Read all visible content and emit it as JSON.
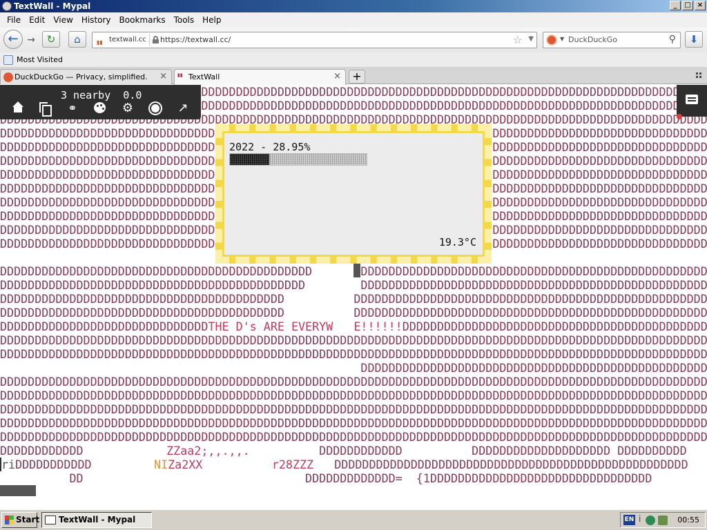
{
  "window": {
    "title": "TextWall - Mypal",
    "controls": {
      "minimize": "_",
      "maximize": "□",
      "close": "×"
    }
  },
  "menu": [
    "File",
    "Edit",
    "View",
    "History",
    "Bookmarks",
    "Tools",
    "Help"
  ],
  "nav": {
    "site_identity": "textwall.cc",
    "url": "https://textwall.cc/",
    "search_placeholder": "DuckDuckGo",
    "icons": [
      "back-icon",
      "forward-icon",
      "reload-icon",
      "home-icon",
      "lock-icon",
      "star-icon",
      "search-icon",
      "download-icon"
    ]
  },
  "bookmarks": {
    "most_visited": "Most Visited"
  },
  "tabs": [
    {
      "label": "DuckDuckGo — Privacy, simplified.",
      "active": false
    },
    {
      "label": "TextWall",
      "active": true
    }
  ],
  "newtab": "+",
  "textwall": {
    "status": "3 nearby  0.0",
    "toolbar_icons": [
      "home-icon",
      "copy-icon",
      "link-icon",
      "palette-icon",
      "settings-icon",
      "brightness-icon",
      "arrow-icon"
    ],
    "billboard": {
      "label": "2022 - 28.95%",
      "progress": 0.2895,
      "temperature": "19.3°C",
      "colors": {
        "frame": "#f3d84a",
        "dash": "#fbf0a8"
      }
    },
    "rows": [
      {
        "text": "DDDDDDDDDDDDDDDDDDDDDDDDDDDDDDDDDDDDDDDDDDDDDDDDDDDDDDDDDDDDDDDDDDDDDDDDDDDDDDDDDDDDDDDDDDDDDDDDDDDDDDDDDDDD"
      },
      {
        "text": "DDDDDDDDDDDDDDDDDDDDDDDDDDDDDDDDDDDDDDDDDDDDDDDDDDDDDDDDDDDDDDDDDDDDDDDDDDDDDDDDDDDDDDDDDDDDDDDDDDDDDDDDDDDDDD"
      },
      {
        "text": "DDDDDDDDDDDDDDDDDDDDDDDDDDDDDDDDDDDDDDDDDDDDDDDDDDDDDDDDDDDDDDDDDDDDDDDDDDDDDDDDDDDDDDDDDDDDDDDDDDDDDDDDDDDDDD"
      },
      {
        "text": "DDDDDDDDDDDDDDDDDDDDDDDDDDDDDDD                                        DDDDDDDDDDDDDDDDDDDDDDDDDDDDDDD"
      },
      {
        "text": "DDDDDDDDDDDDDDDDDDDDDDDDDDDDDDD                                        DDDDDDDDDDDDDDDDDDDDDDDDDDDDDDD"
      },
      {
        "text": "DDDDDDDDDDDDDDDDDDDDDDDDDDDDDDD                                        DDDDDDDDDDDDDDDDDDDDDDDDDDDDDDD"
      },
      {
        "text": "DDDDDDDDDDDDDDDDDDDDDDDDDDDDDDD                                        DDDDDDDDDDDDDDDDDDDDDDDDDDDDDDD"
      },
      {
        "text": "DDDDDDDDDDDDDDDDDDDDDDDDDDDDDDD                                        DDDDDDDDDDDDDDDDDDDDDDDDDDDDDDD"
      },
      {
        "text": "DDDDDDDDDDDDDDDDDDDDDDDDDDDDDDD                                        DDDDDDDDDDDDDDDDDDDDDDDDDDDDDDD"
      },
      {
        "text": "DDDDDDDDDDDDDDDDDDDDDDDDDDDDDDD                                        DDDDDDDDDDDDDDDDDDDDDDDDDDDDDDD"
      },
      {
        "text": "DDDDDDDDDDDDDDDDDDDDDDDDDDDDDDD                                        DDDDDDDDDDDDDDDDDDDDDDDDDDDDDDD"
      },
      {
        "text": "DDDDDDDDDDDDDDDDDDDDDDDDDDDDDDD                                        DDDDDDDDDDDDDDDDDDDDDDDDDDDDDDD"
      },
      {
        "text": ""
      },
      {
        "text": "DDDDDDDDDDDDDDDDDDDDDDDDDDDDDDDDDDDDDDDDDDDDD       DDDDDDDDDDDDDDDDDDDDDDDDDDDDDDDDDDDDDDDDDDDDDDDDDD"
      },
      {
        "text": "DDDDDDDDDDDDDDDDDDDDDDDDDDDDDDDDDDDDDDDDDDDD        DDDDDDDDDDDDDDDDDDDDDDDDDDDDDDDDDDDDDDDDDDDDDDDDDD"
      },
      {
        "text": "DDDDDDDDDDDDDDDDDDDDDDDDDDDDDDDDDDDDDDDDD          DDDDDDDDDDDDDDDDDDDDDDDDDDDDDDDDDDDDDDDDDDDDDDDDDDD"
      },
      {
        "text": "DDDDDDDDDDDDDDDDDDDDDDDDDDDDDDDDDDDDDDDDD          DDDDDDDDDDDDDDDDDDDDDDDDDDDDDDDDDDDDDDDDDDDDDDDDDDD"
      },
      {
        "text": "DDDDDDDDDDDDDDDDDDDDDDDDDDDDDD",
        "msg": "THE D's ARE EVERYW   E!!!!!!",
        "tail": "DDDDDDDDDDDDDDDDDDDDDDDDDDDDDDDDDDDDDDDDDDDDD"
      },
      {
        "text": "DDDDDDDDDDDDDDDDDDDDDDDDDDDDDDDDDDDDDDDDDDDDDDDDDDDDDDDDDDDDDDDDDDDDDDDDDDDDDDDDDDDDDDDDDDDDDDDDDDDDDDDDDDDDDD"
      },
      {
        "text": "DDDDDDDDDDDDDDDDDDDDDDDDDDDDDDDDDDDDDDDDDDDDDDDDDDDDDDDDDDDDDDDDDDDDDDDDDDDDDDDDDDDDDDDDDDDDDDDDDDDDDDDDDDDDDD"
      },
      {
        "text": "                                                    DDDDDDDDDDDDDDDDDDDDDDDDDDDDDDDDDDDDDDDDDDDDDDDDDD"
      },
      {
        "text": "DDDDDDDDDDDDDDDDDDDDDDDDDDDDDDDDDDDDDDDDDDDDDDDDDDDDDDDDDDDDDDDDDDDDDDDDDDDDDDDDDDDDDDDDDDDDDDDDDDDDDDDDDDDDDD"
      },
      {
        "text": "DDDDDDDDDDDDDDDDDDDDDDDDDDDDDDDDDDDDDDDDDDDDDDDDDDDDDDDDDDDDDDDDDDDDDDDDDDDDDDDDDDDDDDDDDDDDDDDDDDDDDDDDDDDDDD"
      },
      {
        "text": "DDDDDDDDDDDDDDDDDDDDDDDDDDDDDDDDDDDDDDDDDDDDDDDDDDDDDDDDDDDDDDDDDDDDDDDDDDDDDDDDDDDDDDDDDDDDDDDDDDDDDDDDDDDDDD"
      },
      {
        "text": "DDDDDDDDDDDDDDDDDDDDDDDDDDDDDDDDDDDDDDDDDDDDDDDDDDDDDDDDDDDDDDDDDDDDDDDDDDDDDDDDDDDDDDDDDDDDDDDDDDDDDDDDDDDDDD"
      },
      {
        "text": "DDDDDDDDDDDDDDDDDDDDDDDDDDDDDDDDDDDDDDDDDDDDDDDDDDDDDDDDDDDDDDDDDDDDDDDDDDDDDDDDDDDDDDDDDDDDDDDDDDDDDDDDDDDDDD"
      },
      {
        "text": "DDDDDDDDDDDD            ",
        "msg": "ZZaa2;,,.,,.",
        "tail": "          DDDDDDDDDDDD          DDDDDDDDDDDDDDDDDDDD DDDDDDDDDD"
      },
      {
        "cursor": "ri",
        "text": "DDDDDDDDDDD         ",
        "orange": "NI",
        "msg": "Za2XX",
        "gap": "          ",
        "msg2": "r28ZZZ",
        "tail": "   DDDDDDDDDDDDDDDDDDDDDDDDDDDDDDDDDDDDDDDDDDDDDDDDDDD"
      },
      {
        "text": "          DD                                DDDDDDDDDDDDD=  {1DDDDDDDDDDDDDDDDDDDDDDDDDDDDDDDD"
      }
    ]
  },
  "taskbar": {
    "start": "Start",
    "task": "TextWall - Mypal",
    "lang": "EN",
    "tray_info": "i",
    "clock": "00:55"
  }
}
